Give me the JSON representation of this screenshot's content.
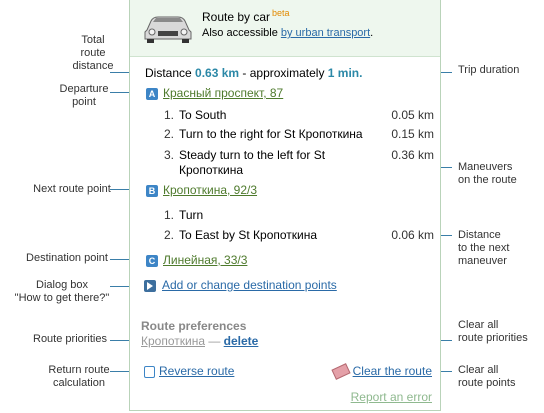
{
  "callouts": {
    "total_route_distance": "Total\nroute\ndistance",
    "departure_point": "Departure\npoint",
    "next_route_point": "Next route point",
    "destination_point": "Destination point",
    "dialog_box": "Dialog box\n\"How to get there?\"",
    "route_priorities": "Route priorities",
    "return_route_calculation": "Return route\ncalculation",
    "trip_duration": "Trip duration",
    "maneuvers_on_route": "Maneuvers\non the route",
    "distance_to_next_maneuver": "Distance\nto the next\nmaneuver",
    "clear_all_route_priorities": "Clear all\nroute priorities",
    "clear_all_route_points": "Clear all\nroute points"
  },
  "header": {
    "title": "Route by car",
    "badge": "beta",
    "subtitle_prefix": "Also accessible ",
    "subtitle_link": "by urban transport",
    "subtitle_suffix": "."
  },
  "summary": {
    "distance_label": "Distance ",
    "distance_value": "0.63 km",
    "approx_label": " - approximately ",
    "duration_value": "1 min."
  },
  "points": [
    {
      "marker": "A",
      "label": "Красный проспект, 87"
    },
    {
      "marker": "B",
      "label": "Кропоткина, 92/3"
    },
    {
      "marker": "C",
      "label": "Линейная, 33/3"
    }
  ],
  "segment_a_steps": [
    {
      "num": "1.",
      "text": "To South",
      "dist": "0.05 km"
    },
    {
      "num": "2.",
      "text": "Turn to the right for St Кропоткина",
      "dist": "0.15 km"
    },
    {
      "num": "3.",
      "text": "Steady turn to the left for St Кропоткина",
      "dist": "0.36 km"
    }
  ],
  "segment_b_steps": [
    {
      "num": "1.",
      "text": "Turn",
      "dist": ""
    },
    {
      "num": "2.",
      "text": "To East by St Кропоткина",
      "dist": "0.06 km"
    }
  ],
  "actions": {
    "add_destination": "Add or change destination points",
    "preferences_title": "Route preferences",
    "priority_item": "Кропоткина",
    "priority_sep": " — ",
    "delete": "delete",
    "reverse": "Reverse route",
    "clear": "Clear the route",
    "report": "Report an error"
  },
  "colors": {
    "accent_teal": "#2b88a7",
    "link_blue": "#2a6aa7",
    "point_green": "#4e7a2c",
    "callout_line": "#3a7ea8"
  }
}
